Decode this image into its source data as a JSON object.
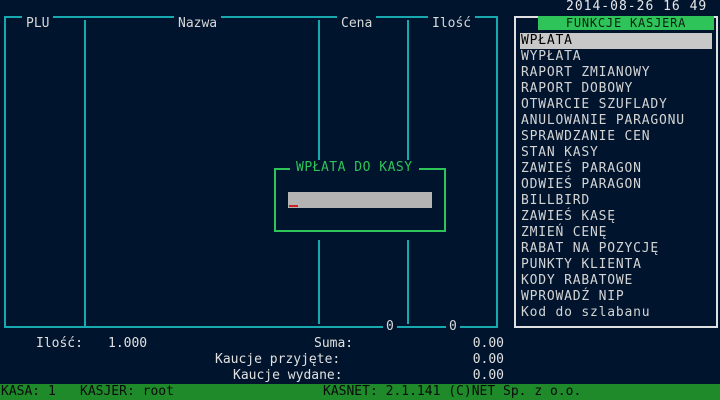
{
  "header": {
    "datetime": "2014-08-26 16 49"
  },
  "table": {
    "columns": [
      "PLU",
      "Nazwa",
      "Cena",
      "Ilość"
    ],
    "footer_zeros": [
      "0",
      "0"
    ]
  },
  "dialog": {
    "title": "WPŁATA DO KASY",
    "input_value": ""
  },
  "panel": {
    "title": "FUNKCJE KASJERA",
    "items": [
      "WPŁATA",
      "WYPŁATA",
      "RAPORT ZMIANOWY",
      "RAPORT DOBOWY",
      "OTWARCIE SZUFLADY",
      "ANULOWANIE PARAGONU",
      "SPRAWDZANIE CEN",
      "STAN KASY",
      "ZAWIEŚ PARAGON",
      "ODWIEŚ PARAGON",
      "BILLBIRD",
      "ZAWIEŚ KASĘ",
      "ZMIEŃ CENĘ",
      "RABAT NA POZYCJĘ",
      "PUNKTY KLIENTA",
      "KODY RABATOWE",
      "WPROWADŹ NIP",
      "Kod do szlabanu"
    ],
    "selected_index": 0
  },
  "summary": {
    "quantity_label": "Ilość:",
    "quantity_value": "1.000",
    "sum_label": "Suma:",
    "sum_value": "0.00",
    "deposits_in_label": "Kaucje przyjęte:",
    "deposits_in_value": "0.00",
    "deposits_out_label": "Kaucje wydane:",
    "deposits_out_value": "0.00"
  },
  "statusbar": {
    "kasa": "KASA: 1",
    "kasjer": "KASJER: root",
    "app": "KASNET: 2.1.141 (C)NET Sp. z o.o."
  },
  "colors": {
    "background": "#00142d",
    "frame_cyan": "#18a8b0",
    "accent_green": "#2ec45a",
    "statusbar_green": "#1e8a2a",
    "selection": "#c8c8c8"
  }
}
